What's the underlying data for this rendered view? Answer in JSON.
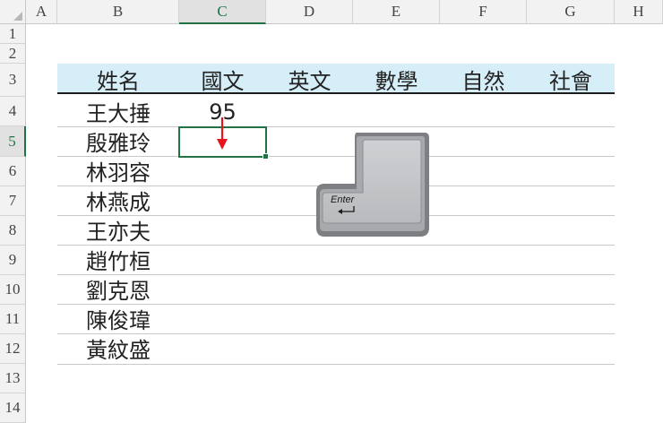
{
  "sheet": {
    "columns": [
      "A",
      "B",
      "C",
      "D",
      "E",
      "F",
      "G",
      "H"
    ],
    "rows": [
      "1",
      "2",
      "3",
      "4",
      "5",
      "6",
      "7",
      "8",
      "9",
      "10",
      "11",
      "12",
      "13",
      "14"
    ],
    "selected_column": "C",
    "selected_row": "5"
  },
  "table": {
    "headers": [
      "姓名",
      "國文",
      "英文",
      "數學",
      "自然",
      "社會"
    ],
    "names": [
      "王大捶",
      "殷雅玲",
      "林羽容",
      "林燕成",
      "王亦夫",
      "趙竹桓",
      "劉克恩",
      "陳俊瑋",
      "黃紋盛"
    ],
    "score_value": "95"
  },
  "key": {
    "label": "Enter",
    "icon": "enter-arrow-icon"
  },
  "colors": {
    "accent": "#217346",
    "header_fill": "#d6eef8",
    "arrow": "#e8141b"
  }
}
